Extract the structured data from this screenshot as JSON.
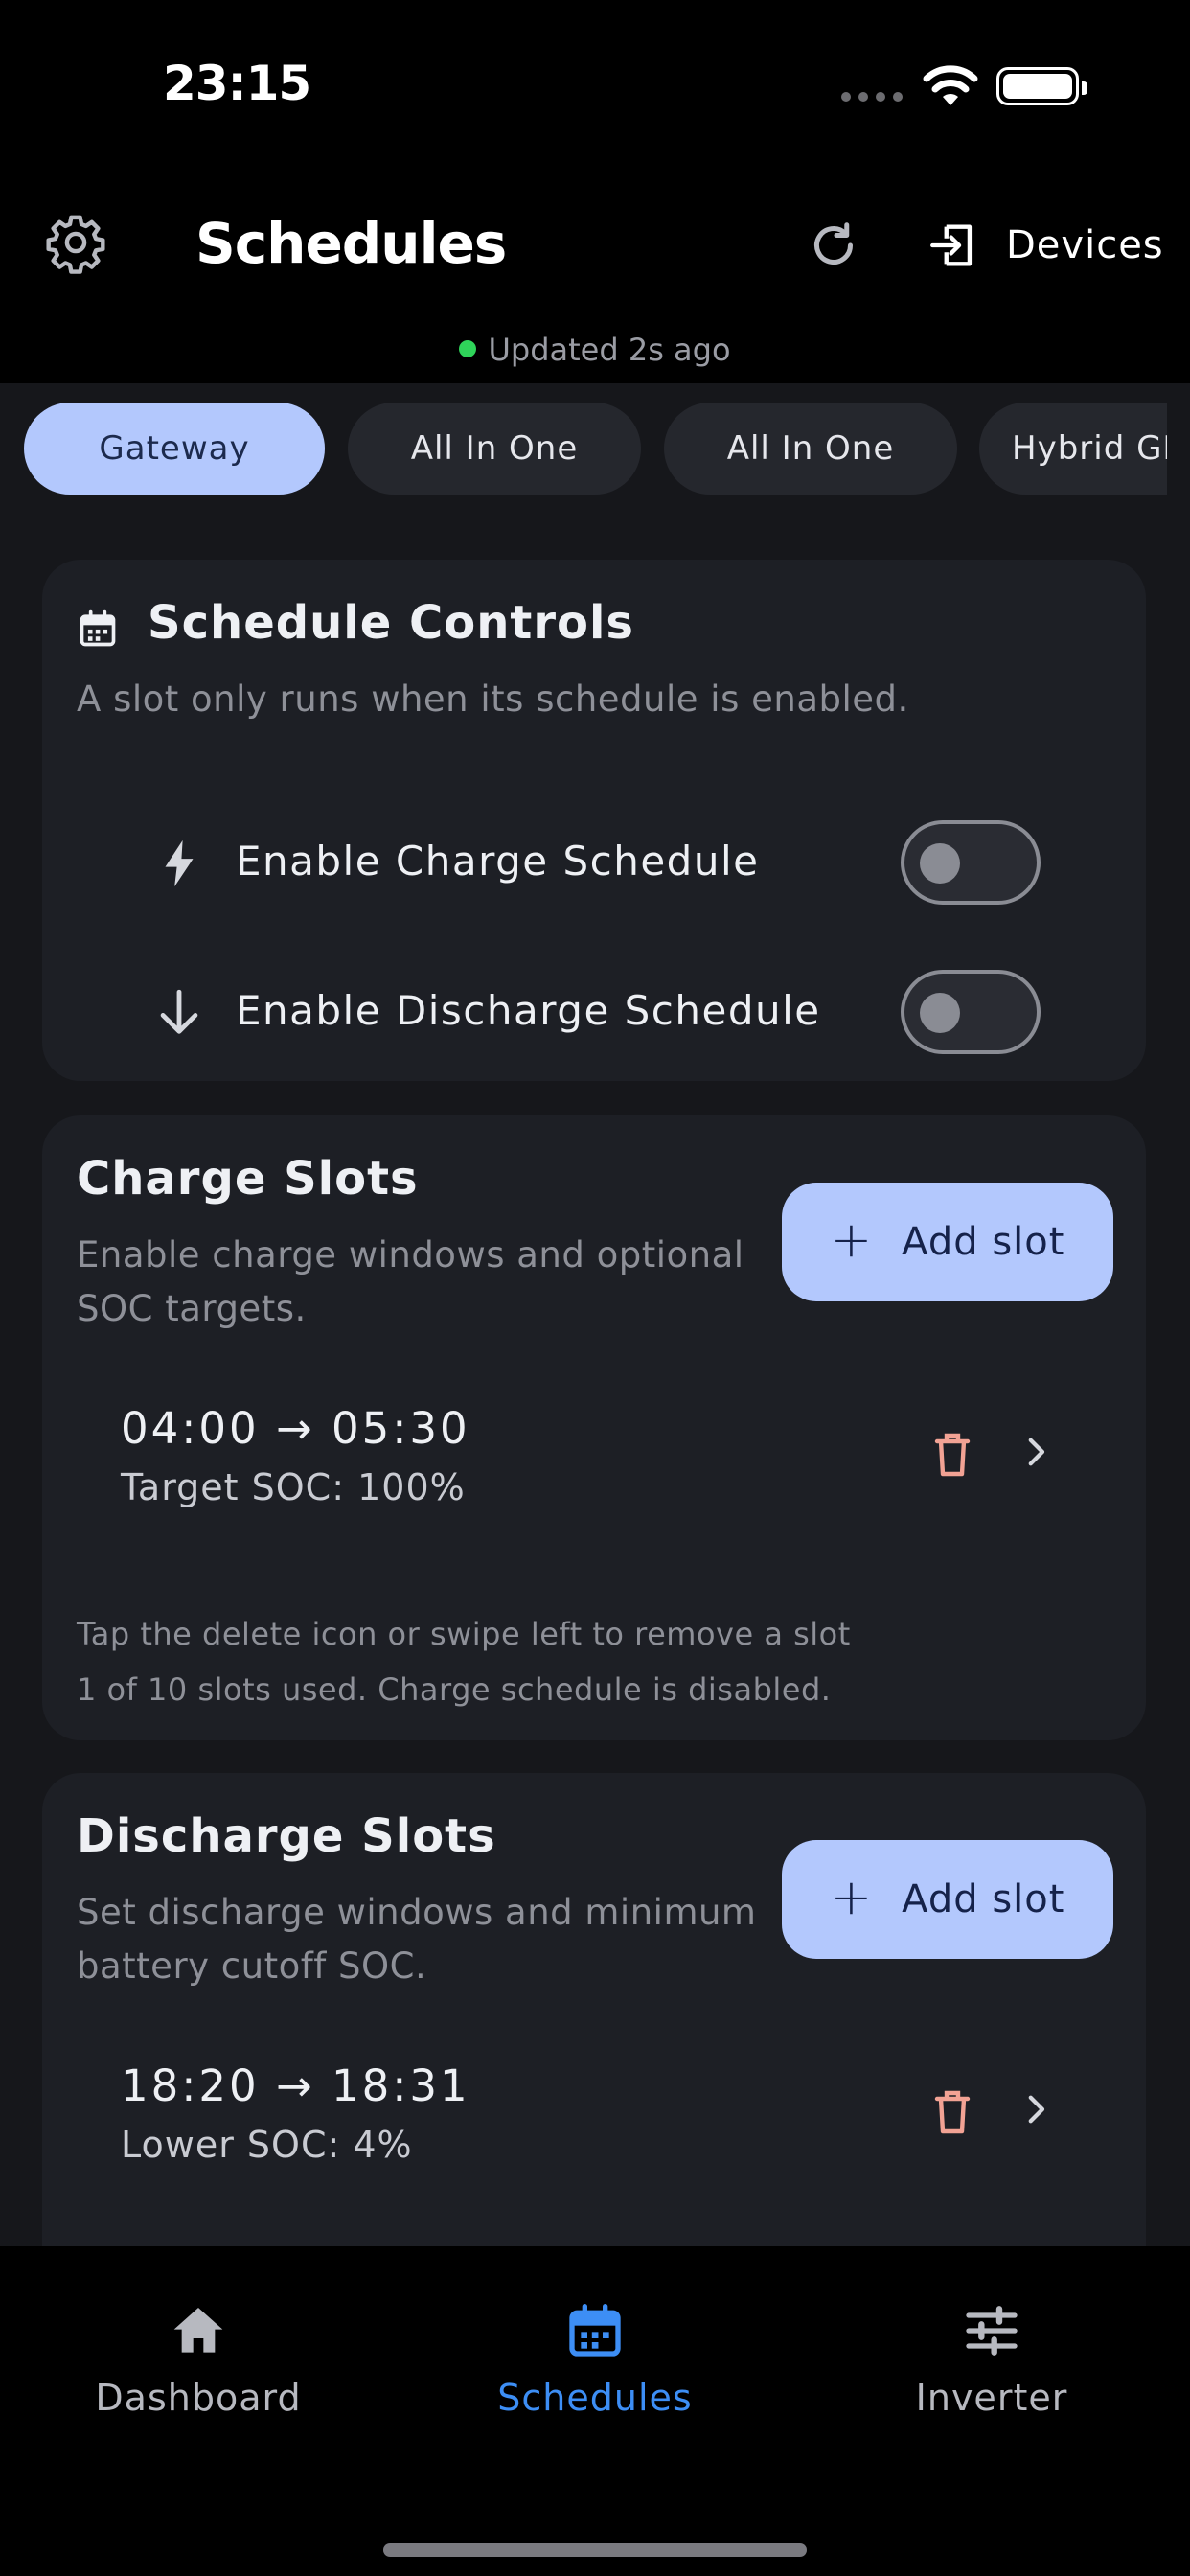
{
  "status_bar": {
    "time": "23:15"
  },
  "header": {
    "title": "Schedules",
    "devices_label": "Devices",
    "updated_text": "Updated 2s ago"
  },
  "device_tabs": [
    {
      "label": "Gateway",
      "active": true
    },
    {
      "label": "All In One",
      "active": false
    },
    {
      "label": "All In One",
      "active": false
    },
    {
      "label": "Hybrid GEN",
      "active": false
    }
  ],
  "schedule_controls": {
    "title": "Schedule Controls",
    "subtitle": "A slot only runs when its schedule is enabled.",
    "charge_toggle_label": "Enable Charge Schedule",
    "charge_enabled": false,
    "discharge_toggle_label": "Enable Discharge Schedule",
    "discharge_enabled": false
  },
  "charge_slots": {
    "title": "Charge Slots",
    "subtitle_line1": "Enable charge windows and optional",
    "subtitle_line2": "SOC targets.",
    "add_label": "Add slot",
    "slots": [
      {
        "time": "04:00 → 05:30",
        "soc": "Target SOC: 100%"
      }
    ],
    "hint": "Tap the delete icon or swipe left to remove a slot",
    "usage": "1 of 10 slots used. Charge schedule is disabled."
  },
  "discharge_slots": {
    "title": "Discharge Slots",
    "subtitle_line1": "Set discharge windows and minimum",
    "subtitle_line2": "battery cutoff SOC.",
    "add_label": "Add slot",
    "slots": [
      {
        "time": "18:20 → 18:31",
        "soc": "Lower SOC: 4%"
      }
    ]
  },
  "bottom_nav": {
    "items": [
      {
        "label": "Dashboard",
        "icon": "home-icon",
        "active": false
      },
      {
        "label": "Schedules",
        "icon": "calendar-icon",
        "active": true
      },
      {
        "label": "Inverter",
        "icon": "sliders-icon",
        "active": false
      }
    ]
  },
  "colors": {
    "accent": "#b3c8fd",
    "nav_active": "#3d8ef5",
    "delete": "#f2a294",
    "online_dot": "#2fd45a"
  }
}
